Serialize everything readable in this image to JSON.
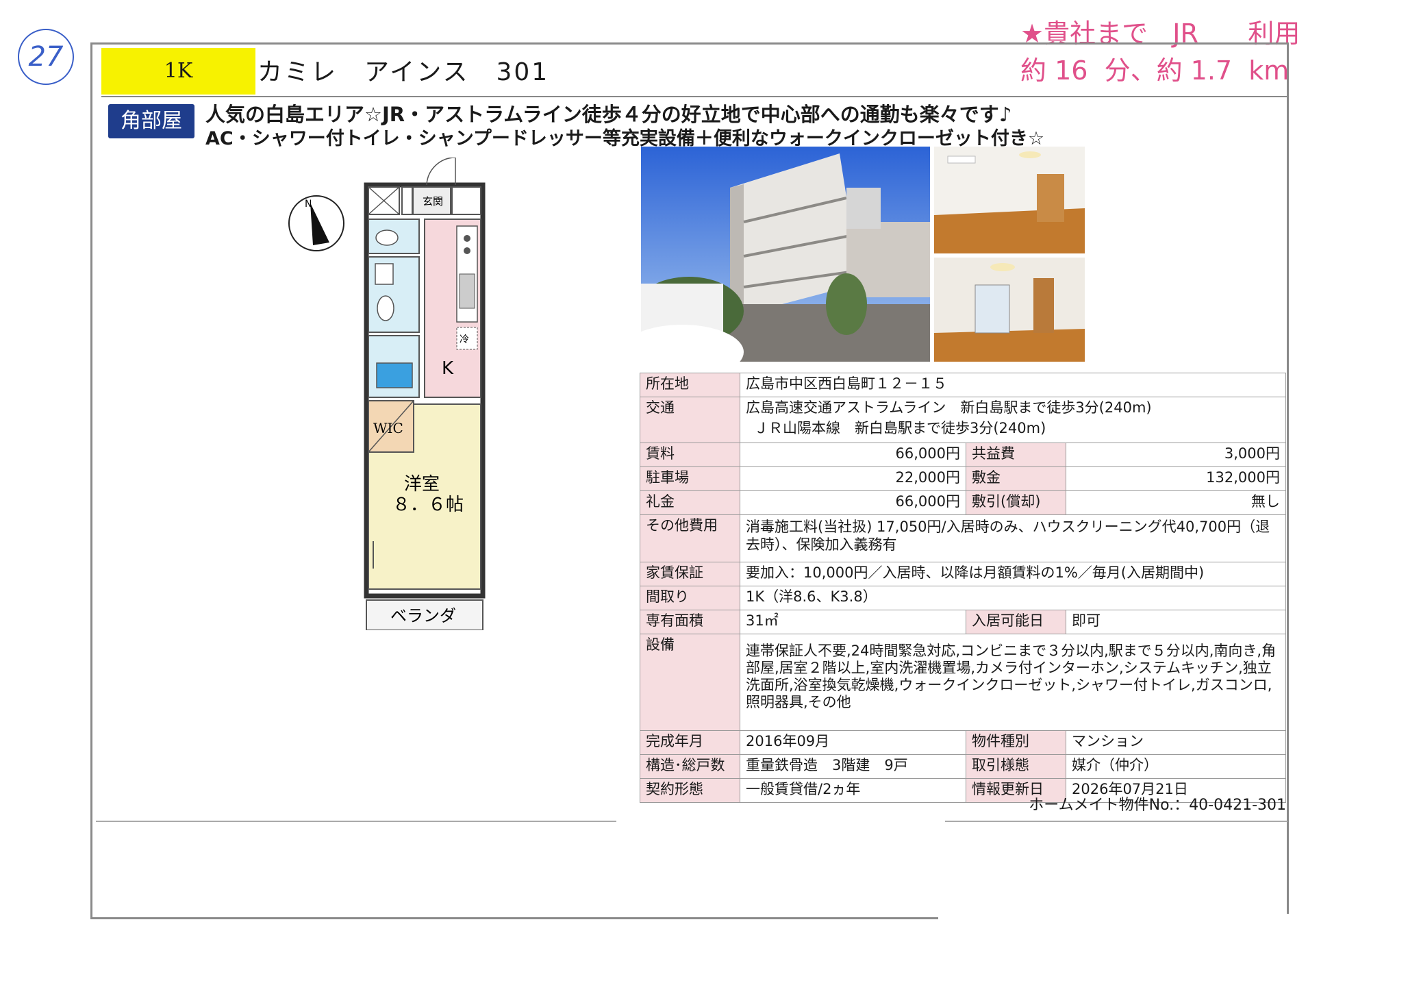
{
  "sheet_number": "27",
  "handwritten_note": {
    "line1": "★貴社まで   JR      利用",
    "line2": "約 16  分、約 1.7  km"
  },
  "header": {
    "layout": "1K",
    "title": "カミレ　アインス　301",
    "badge": "角部屋",
    "catch1": "人気の白島エリア☆JR・アストラムライン徒歩４分の好立地で中心部への通勤も楽々です♪",
    "catch2": "AC・シャワー付トイレ・シャンプードレッサー等充実設備＋便利なウォークインクローゼット付き☆"
  },
  "floorplan": {
    "entrance": "玄関",
    "fridge": "冷",
    "kitchen": "K",
    "wic": "WIC",
    "room_name": "洋室",
    "room_size": "８．６帖",
    "balcony": "ベランダ",
    "north": "N"
  },
  "details": {
    "address_label": "所在地",
    "address": "広島市中区西白島町１２－１５",
    "transport_label": "交通",
    "transport1": "広島高速交通アストラムライン　新白島駅まで徒歩3分(240m)",
    "transport2": "ＪＲ山陽本線　新白島駅まで徒歩3分(240m)",
    "rent_label": "賃料",
    "rent": "66,000円",
    "common_fee_label": "共益費",
    "common_fee": "3,000円",
    "parking_label": "駐車場",
    "parking": "22,000円",
    "deposit_label": "敷金",
    "deposit": "132,000円",
    "key_money_label": "礼金",
    "key_money": "66,000円",
    "deduction_label": "敷引(償却)",
    "deduction": "無し",
    "other_fees_label": "その他費用",
    "other_fees": "消毒施工料(当社扱) 17,050円/入居時のみ、ハウスクリーニング代40,700円（退去時）、保険加入義務有",
    "guarantee_label": "家賃保証",
    "guarantee": "要加入：10,000円／入居時、以降は月額賃料の1%／毎月(入居期間中)",
    "floorplan_label": "間取り",
    "floorplan_value": "1K（洋8.6、K3.8）",
    "area_label": "専有面積",
    "area": "31㎡",
    "move_in_label": "入居可能日",
    "move_in": "即可",
    "facilities_label": "設備",
    "facilities": "連帯保証人不要,24時間緊急対応,コンビニまで３分以内,駅まで５分以内,南向き,角部屋,居室２階以上,室内洗濯機置場,カメラ付インターホン,システムキッチン,独立洗面所,浴室換気乾燥機,ウォークインクローゼット,シャワー付トイレ,ガスコンロ,照明器具,その他",
    "built_label": "完成年月",
    "built": "2016年09月",
    "type_label": "物件種別",
    "type": "マンション",
    "structure_label": "構造･総戸数",
    "structure": "重量鉄骨造　3階建　9戸",
    "transaction_label": "取引様態",
    "transaction": "媒介（仲介）",
    "contract_label": "契約形態",
    "contract": "一般賃貸借/2ヵ年",
    "updated_label": "情報更新日",
    "updated": "2026年07月21日"
  },
  "footer": {
    "property_no": "ホームメイト物件No.：40-0421-301"
  },
  "colors": {
    "badge": "#1f3d8c",
    "highlight": "#f7f200",
    "handwriting": "#e0508a",
    "header_cell": "#f6dde0"
  }
}
